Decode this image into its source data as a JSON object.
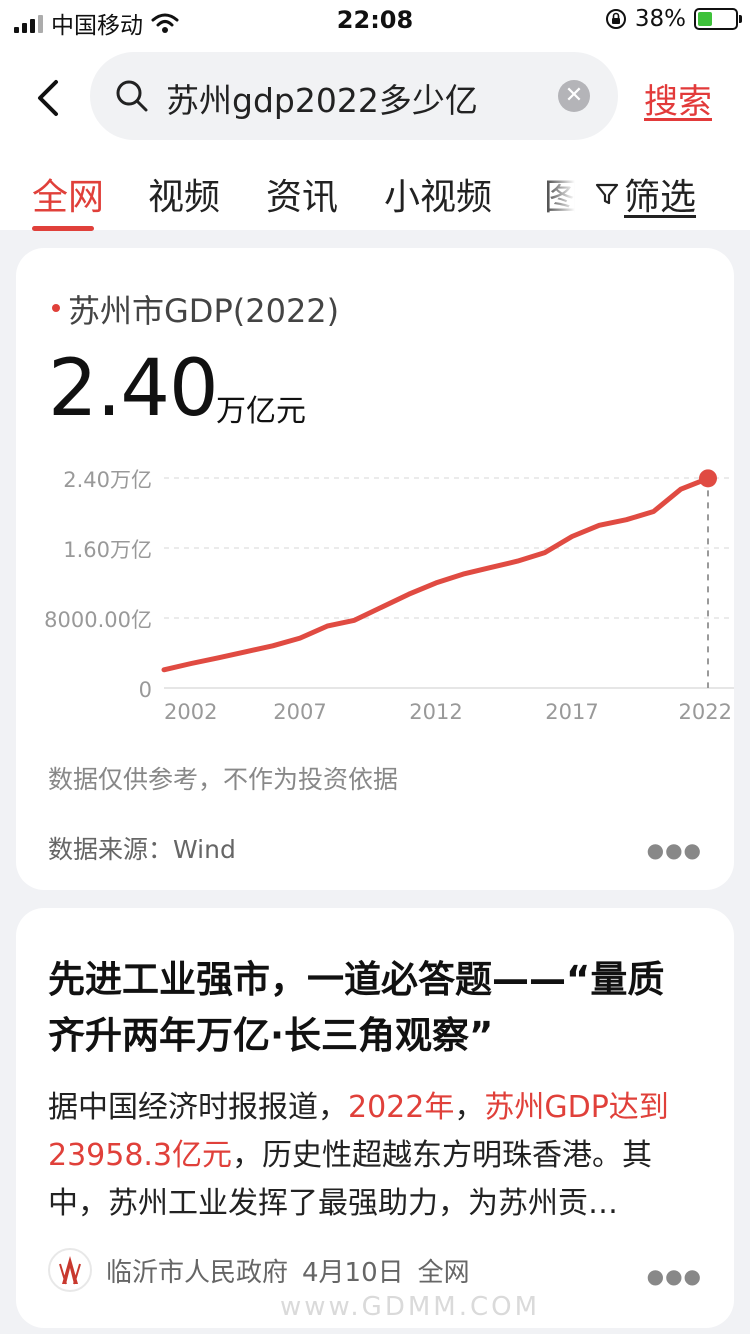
{
  "status_bar": {
    "carrier": "中国移动",
    "time": "22:08",
    "battery_text": "38%",
    "battery_level": 0.38
  },
  "search": {
    "query": "苏州gdp2022多少亿",
    "submit_label": "搜索"
  },
  "tabs": [
    {
      "label": "全网",
      "active": true
    },
    {
      "label": "视频",
      "active": false
    },
    {
      "label": "资讯",
      "active": false
    },
    {
      "label": "小视频",
      "active": false
    },
    {
      "label": "图",
      "active": false
    }
  ],
  "filter_label": "筛选",
  "kpi_card": {
    "label": "苏州市GDP(2022)",
    "value": "2.40",
    "unit": "万亿元",
    "disclaimer": "数据仅供参考，不作为投资依据",
    "source_label": "数据来源：",
    "source_value": "Wind"
  },
  "chart_data": {
    "type": "line",
    "x": [
      2002,
      2003,
      2004,
      2005,
      2006,
      2007,
      2008,
      2009,
      2010,
      2011,
      2012,
      2013,
      2014,
      2015,
      2016,
      2017,
      2018,
      2019,
      2020,
      2021,
      2022
    ],
    "series": [
      {
        "values": [
          2080,
          2801,
          3450,
          4138,
          4820,
          5701,
          7078,
          7740,
          9229,
          10717,
          12012,
          13016,
          13761,
          14504,
          15475,
          17319,
          18597,
          19236,
          20171,
          22718,
          23958
        ]
      }
    ],
    "y_ticks": [
      {
        "value": 0,
        "label": "0"
      },
      {
        "value": 8000,
        "label": "8000.00亿"
      },
      {
        "value": 16000,
        "label": "1.60万亿"
      },
      {
        "value": 24000,
        "label": "2.40万亿"
      }
    ],
    "x_ticks": [
      "2002",
      "2007",
      "2012",
      "2017",
      "2022"
    ],
    "ylim": [
      0,
      24000
    ],
    "grid": true,
    "highlight_last_point": true,
    "line_color": "#e04b42"
  },
  "article": {
    "title": "先进工业强市，一道必答题——“量质齐升两年万亿·长三角观察”",
    "summary_parts": [
      {
        "text": "据中国经济时报报道，",
        "hl": false
      },
      {
        "text": "2022年",
        "hl": true
      },
      {
        "text": "，",
        "hl": false
      },
      {
        "text": "苏州GDP达到23958.3亿元",
        "hl": true
      },
      {
        "text": "，历史性超越东方明珠香港。其中，苏州工业发挥了最强助力，为苏州贡…",
        "hl": false
      }
    ],
    "source": "临沂市人民政府",
    "date": "4月10日",
    "channel": "全网"
  },
  "watermark": "www.GDMM.COM",
  "colors": {
    "accent": "#e0403a"
  }
}
